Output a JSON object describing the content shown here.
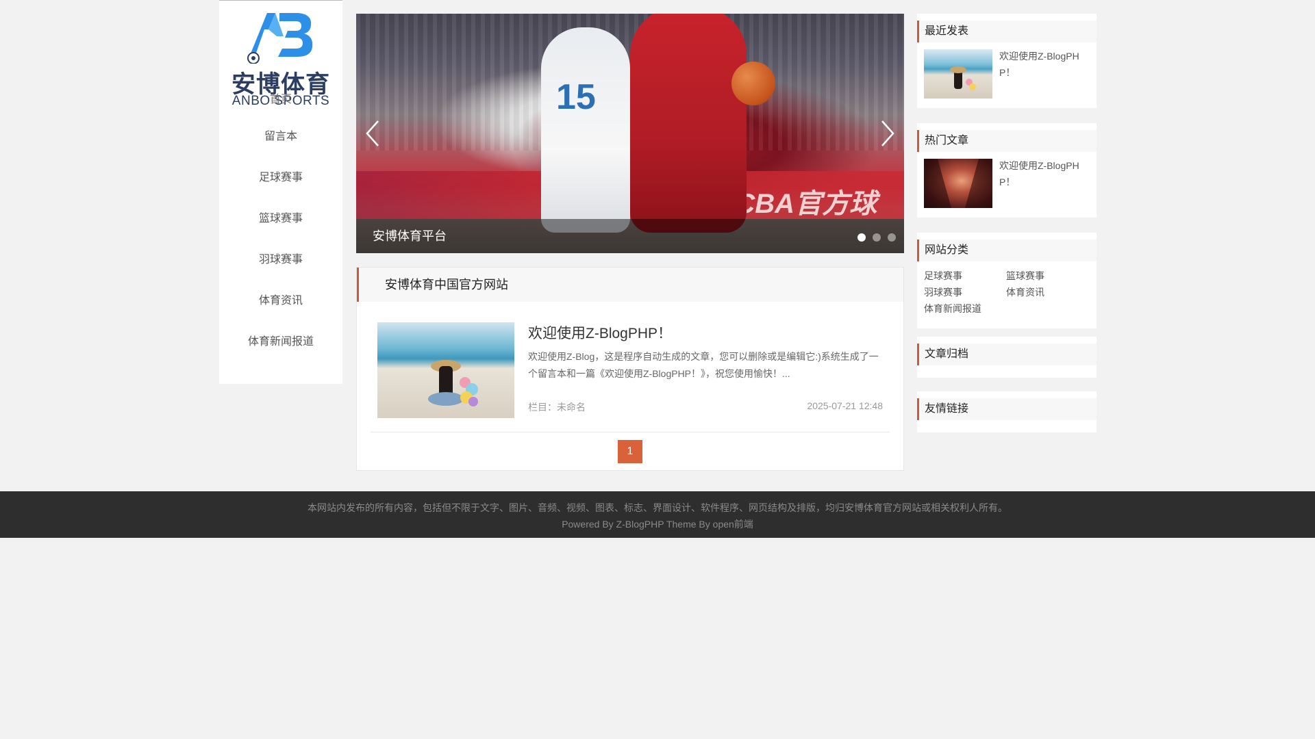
{
  "logo": {
    "cn": "安博体育",
    "en": "ANBO SPORTS",
    "mark": "AB"
  },
  "nav": {
    "items": [
      {
        "label": "首页"
      },
      {
        "label": "留言本"
      },
      {
        "label": "足球赛事"
      },
      {
        "label": "篮球赛事"
      },
      {
        "label": "羽球赛事"
      },
      {
        "label": "体育资讯"
      },
      {
        "label": "体育新闻报道"
      }
    ]
  },
  "slider": {
    "caption": "安博体育平台",
    "jersey_number": "15",
    "banner_text": "威| 惠| CBA官方球",
    "slide_count": 3,
    "active_slide": 1,
    "prev_icon": "chevron-left-icon",
    "next_icon": "chevron-right-icon"
  },
  "main": {
    "section_title": "安博体育中国官方网站",
    "post": {
      "title": "欢迎使用Z-BlogPHP！",
      "excerpt": "欢迎使用Z-Blog，这是程序自动生成的文章，您可以删除或是编辑它:)系统生成了一个留言本和一篇《欢迎使用Z-BlogPHP！》，祝您使用愉快！...",
      "category": "栏目：未命名",
      "date": "2025-07-21 12:48"
    },
    "pager": {
      "current": "1"
    }
  },
  "widgets": {
    "recent": {
      "title": "最近发表",
      "post_title": "欢迎使用Z-BlogPHP！"
    },
    "hot": {
      "title": "热门文章",
      "post_title": "欢迎使用Z-BlogPHP！"
    },
    "categories": {
      "title": "网站分类",
      "items": [
        "足球赛事",
        "篮球赛事",
        "羽球赛事",
        "体育资讯",
        "体育新闻报道"
      ]
    },
    "archive": {
      "title": "文章归档"
    },
    "links": {
      "title": "友情链接"
    }
  },
  "footer": {
    "copyright": "本网站内发布的所有内容，包括但不限于文字、图片、音频、视频、图表、标志、界面设计、软件程序、网页结构及排版，均归安博体育官方网站或相关权利人所有。",
    "powered": "Powered By Z-BlogPHP Theme By open前端"
  },
  "colors": {
    "accent": "#d9623b",
    "widget_border": "#c95a3a",
    "footer_bg": "#2e2e2e",
    "logo_blue": "#2e8fe6",
    "logo_text": "#2b3d62"
  }
}
